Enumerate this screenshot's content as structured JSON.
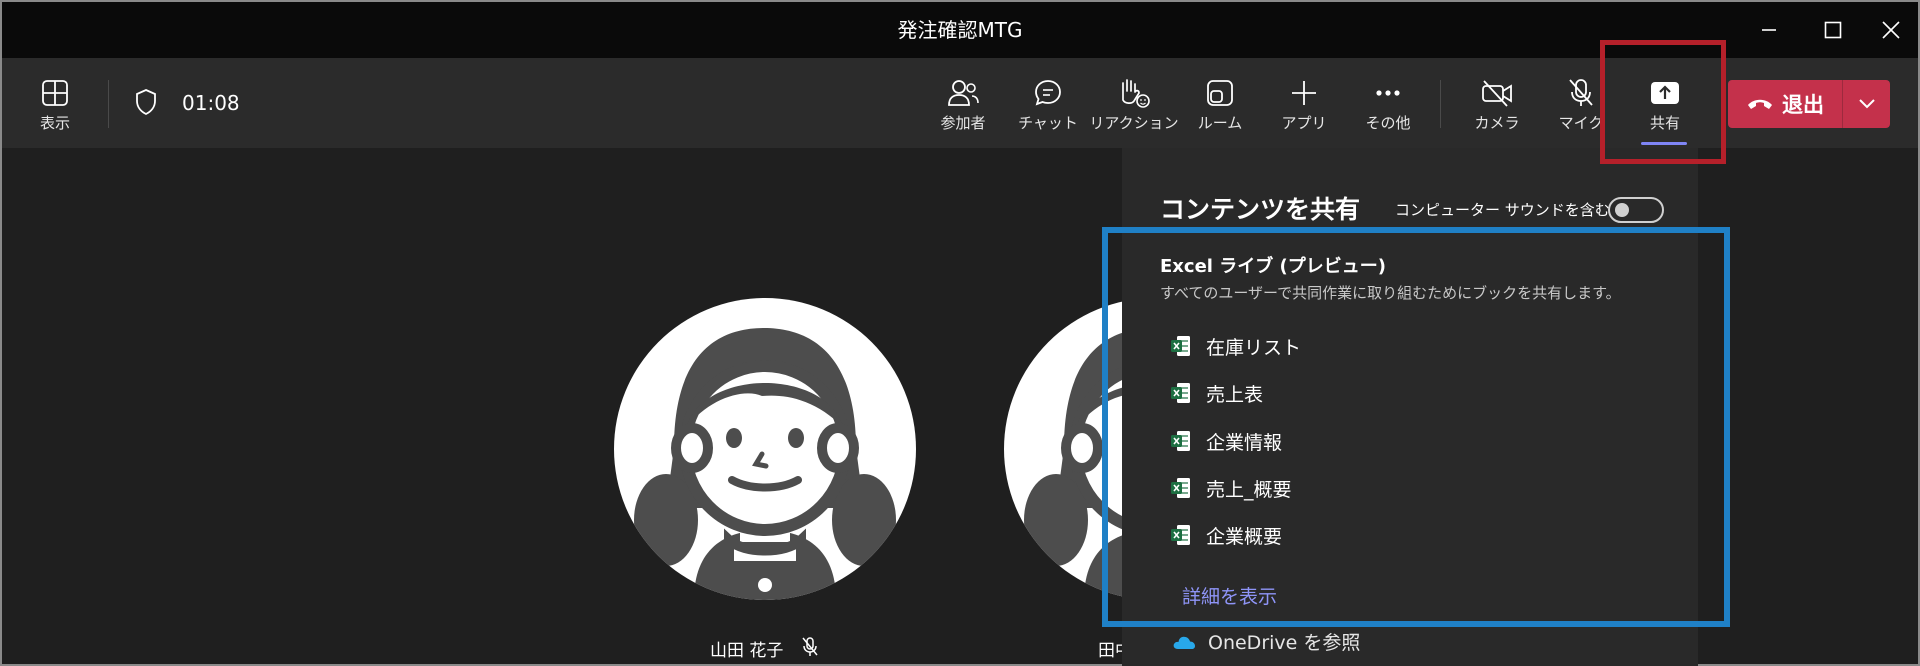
{
  "window": {
    "title": "発注確認MTG"
  },
  "toolbar": {
    "view_label": "表示",
    "timer": "01:08",
    "buttons": [
      {
        "id": "participants",
        "label": "参加者",
        "icon": "people-icon"
      },
      {
        "id": "chat",
        "label": "チャット",
        "icon": "chat-icon"
      },
      {
        "id": "reactions",
        "label": "リアクション",
        "icon": "raise-hand-icon"
      },
      {
        "id": "rooms",
        "label": "ルーム",
        "icon": "breakout-rooms-icon"
      },
      {
        "id": "apps",
        "label": "アプリ",
        "icon": "plus-icon"
      },
      {
        "id": "more",
        "label": "その他",
        "icon": "more-icon"
      },
      {
        "id": "camera",
        "label": "カメラ",
        "icon": "camera-off-icon"
      },
      {
        "id": "mic",
        "label": "マイク",
        "icon": "mic-off-icon"
      },
      {
        "id": "share",
        "label": "共有",
        "icon": "share-screen-icon"
      }
    ],
    "leave_label": "退出"
  },
  "stage": {
    "participants": [
      {
        "name": "山田 花子",
        "muted": true
      },
      {
        "name": "田中"
      }
    ]
  },
  "share_panel": {
    "title": "コンテンツを共有",
    "sound_label": "コンピューター サウンドを含む",
    "sound_on": false,
    "section_title": "Excel ライブ (プレビュー)",
    "section_subtitle": "すべてのユーザーで共同作業に取り組むためにブックを共有します。",
    "files": [
      "在庫リスト",
      "売上表",
      "企業情報",
      "売上_概要",
      "企業概要"
    ],
    "more_link": "詳細を表示",
    "onedrive_label": "OneDrive を参照"
  },
  "colors": {
    "accent": "#7f85f5",
    "leave": "#c4314b",
    "excel": "#1d6f42",
    "highlight_red": "#b5202a",
    "highlight_blue": "#1f80c6"
  }
}
